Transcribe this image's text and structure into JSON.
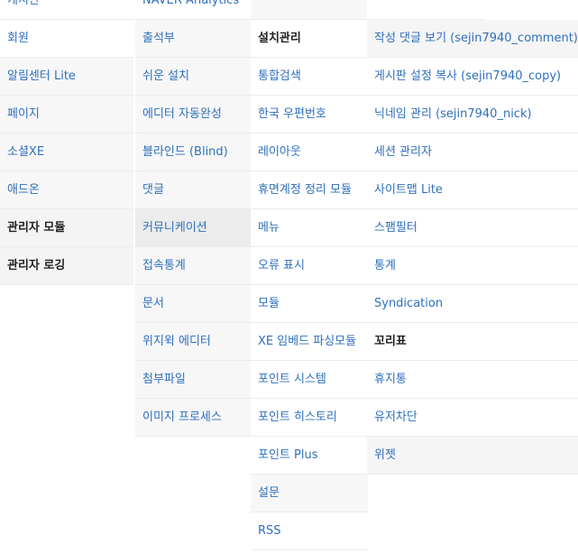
{
  "col1": [
    "게시판",
    "회원",
    "알림센터 Lite",
    "페이지",
    "소셜XE",
    "애드온",
    "관리자 모듈",
    "관리자 로깅"
  ],
  "col2": [
    "NAVER Analytics",
    "출석부",
    "쉬운 설치",
    "에디터 자동완성",
    "블라인드 (Blind)",
    "댓글",
    "커뮤니케이션",
    "접속통계",
    "문서",
    "위지윅 에디터",
    "첨부파일",
    "이미지 프로세스"
  ],
  "col3": [
    "",
    "설치관리",
    "통합검색",
    "한국 우편번호",
    "레이아웃",
    "휴면계정 정리 모듈",
    "메뉴",
    "오류 표시",
    "모듈",
    "XE 임베드 파싱모듈",
    "포인트 시스템",
    "포인트 히스토리",
    "포인트 Plus",
    "설문",
    "RSS"
  ],
  "col4": [
    "",
    "작성 댓글 보기 (sejin7940_comment)",
    "게시판 설정 복사 (sejin7940_copy)",
    "닉네임 관리 (sejin7940_nick)",
    "세션 관리자",
    "사이트맵 Lite",
    "스팸필터",
    "통계",
    "Syndication",
    "꼬리표",
    "휴지통",
    "유저차단",
    "위젯"
  ]
}
